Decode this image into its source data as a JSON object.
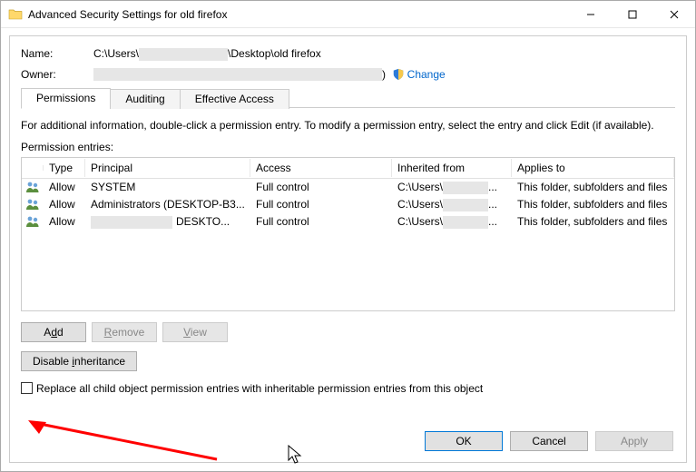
{
  "window": {
    "title": "Advanced Security Settings for old firefox"
  },
  "fields": {
    "name_label": "Name:",
    "name_value_prefix": "C:\\Users\\",
    "name_value_suffix": "\\Desktop\\old firefox",
    "owner_label": "Owner:",
    "owner_value_suffix": ")",
    "change_label": "Change"
  },
  "tabs": {
    "permissions": "Permissions",
    "auditing": "Auditing",
    "effective": "Effective Access"
  },
  "info_text": "For additional information, double-click a permission entry. To modify a permission entry, select the entry and click Edit (if available).",
  "perm_entries_label": "Permission entries:",
  "columns": {
    "type": "Type",
    "principal": "Principal",
    "access": "Access",
    "inherited": "Inherited from",
    "applies": "Applies to"
  },
  "entries": [
    {
      "type": "Allow",
      "principal": "SYSTEM",
      "access": "Full control",
      "inherited": "C:\\Users\\",
      "applies": "This folder, subfolders and files"
    },
    {
      "type": "Allow",
      "principal": "Administrators (DESKTOP-B3...",
      "access": "Full control",
      "inherited": "C:\\Users\\",
      "applies": "This folder, subfolders and files"
    },
    {
      "type": "Allow",
      "principal": "DESKTO...",
      "principal_redacted": true,
      "access": "Full control",
      "inherited": "C:\\Users\\",
      "applies": "This folder, subfolders and files"
    }
  ],
  "buttons": {
    "add": "Add",
    "remove": "Remove",
    "view": "View",
    "disable_inherit": "Disable inheritance",
    "replace_children": "Replace all child object permission entries with inheritable permission entries from this object",
    "ok": "OK",
    "cancel": "Cancel",
    "apply": "Apply"
  }
}
